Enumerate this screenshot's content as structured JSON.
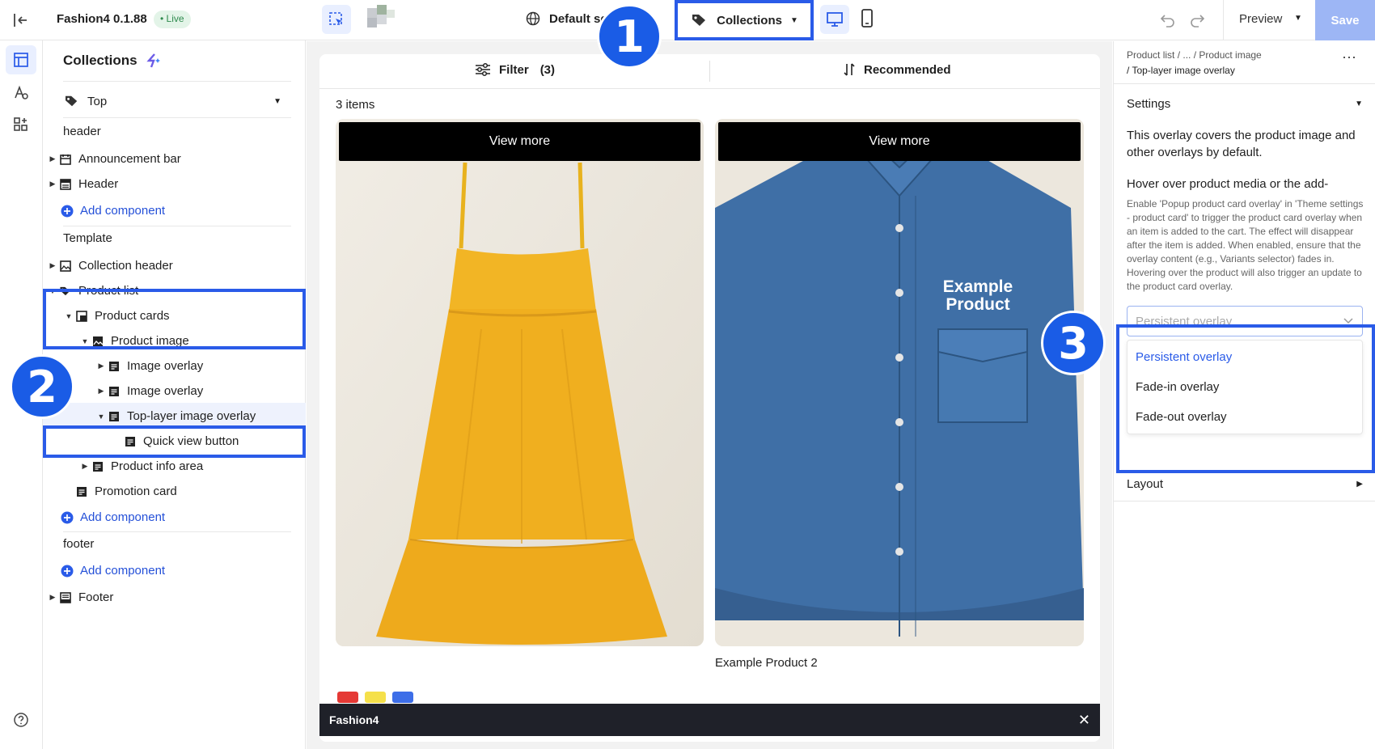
{
  "app": {
    "name": "Fashion4 0.1.88",
    "status": "• Live"
  },
  "topbar": {
    "language": "Default se",
    "page_selector": "Collections",
    "preview_label": "Preview",
    "save_label": "Save"
  },
  "sidebar": {
    "title": "Collections",
    "position_select": "Top",
    "sections": {
      "header": "header",
      "template": "Template",
      "footer": "footer"
    },
    "items": {
      "announcement": "Announcement bar",
      "header": "Header",
      "add1": "Add component",
      "collection_header": "Collection header",
      "product_list": "Product list",
      "product_cards": "Product cards",
      "product_image": "Product image",
      "image_overlay_1": "Image overlay",
      "image_overlay_2": "Image overlay",
      "top_layer": "Top-layer image overlay",
      "quick_view": "Quick view button",
      "product_info": "Product info area",
      "promotion": "Promotion card",
      "add2": "Add component",
      "add3": "Add component",
      "footer": "Footer"
    }
  },
  "shop": {
    "filter_label": "Filter",
    "filter_count": "(3)",
    "sort_label": "Recommended",
    "item_count": "3 items",
    "view_more_1": "View more",
    "view_more_2": "View more",
    "shirt_overlay": "Example Product",
    "product_2_name": "Example Product 2",
    "swatches": [
      "#e53935",
      "#f5e04a",
      "#3d6ee8"
    ],
    "footer_bar": "Fashion4"
  },
  "right_panel": {
    "breadcrumb_line1": "Product list / ... / Product image",
    "breadcrumb_line2": "/ Top-layer image overlay",
    "settings_label": "Settings",
    "description": "This overlay covers the product image and other overlays by default.",
    "hover_title": "Hover over product media or the add-",
    "hover_help": "Enable 'Popup product card overlay' in 'Theme settings - product card' to trigger the product card overlay when an item is added to the cart. The effect will disappear after the item is added. When enabled, ensure that the overlay content (e.g., Variants selector) fades in. Hovering over the product will also trigger an update to the product card overlay.",
    "select_placeholder": "Persistent overlay",
    "options": [
      "Persistent overlay",
      "Fade-in overlay",
      "Fade-out overlay"
    ],
    "layout_label": "Layout"
  },
  "annotations": {
    "badge1": "1",
    "badge2": "2",
    "badge3": "3"
  }
}
